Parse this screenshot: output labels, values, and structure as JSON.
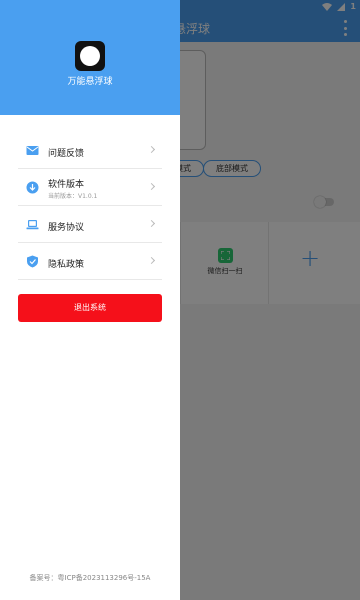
{
  "status_bar": {
    "battery_level": "1"
  },
  "app": {
    "title_fragment": "悬浮球",
    "mode_option_1": "模式",
    "mode_option_2": "底部模式",
    "wechat_tile_label": "微信扫一扫",
    "add_tile_label": "+"
  },
  "drawer": {
    "app_name": "万能悬浮球",
    "menu": [
      {
        "label": "问题反馈",
        "icon": "mail-icon"
      },
      {
        "label": "软件版本",
        "sublabel": "当前版本：V1.0.1",
        "icon": "download-icon"
      },
      {
        "label": "服务协议",
        "icon": "laptop-icon"
      },
      {
        "label": "隐私政策",
        "icon": "shield-icon"
      }
    ],
    "logout_label": "退出系统",
    "icp": "备案号：粤ICP备2023113296号-15A"
  },
  "colors": {
    "primary": "#4a9ff0",
    "logout": "#f5101a",
    "wechat": "#2ecc71"
  }
}
